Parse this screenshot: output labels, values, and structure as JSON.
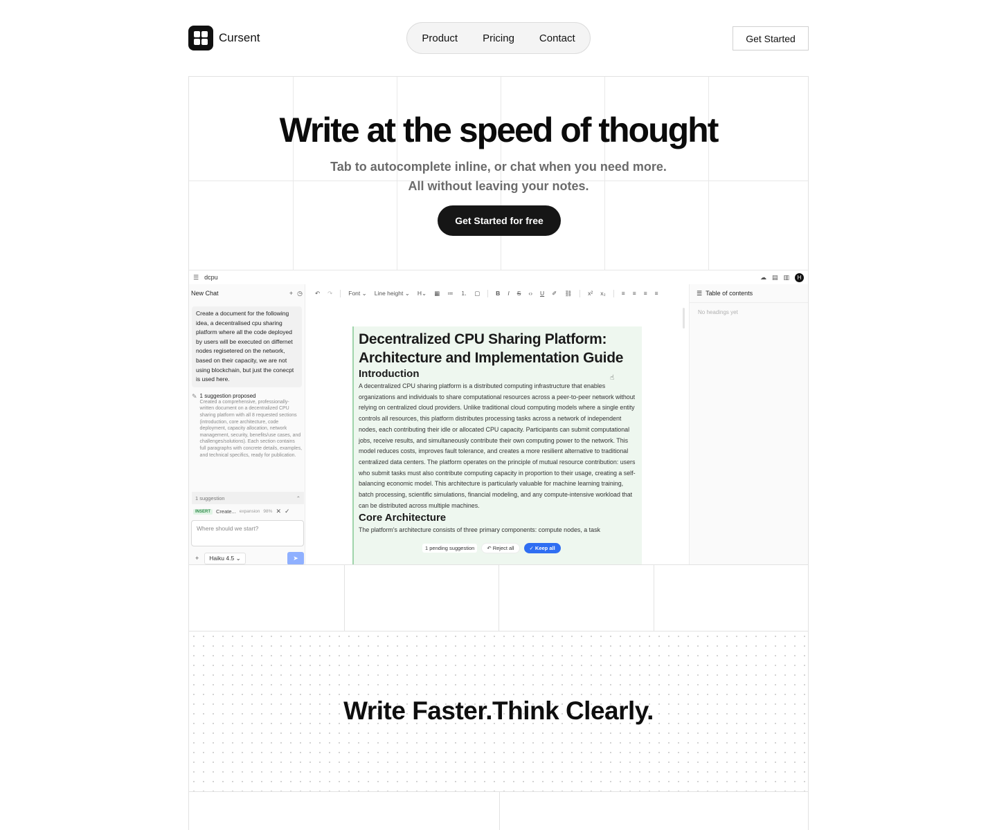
{
  "nav": {
    "brand": "Cursent",
    "links": [
      "Product",
      "Pricing",
      "Contact"
    ],
    "cta": "Get Started"
  },
  "hero": {
    "title": "Write at the speed of thought",
    "subtitle_line1": "Tab to autocomplete inline, or chat when you need more.",
    "subtitle_line2": "All without leaving your notes.",
    "cta": "Get Started for free"
  },
  "app": {
    "doc_name": "dcpu",
    "avatar_initial": "H",
    "chat": {
      "title": "New Chat",
      "user_message": "Create a document for the following idea, a decentralised cpu sharing platform where all the code deployed by users will be executed on differnet nodes regisetered on the network, based on their capacity, we are not using blockchain, but just the conecpt is used here.",
      "suggestion_title": "1 suggestion proposed",
      "suggestion_body": "Created a comprehensive, professionally-written document on a decentralized CPU sharing platform with all 8 requested sections (introduction, core architecture, code deployment, capacity allocation, network management, security, benefits/use cases, and challenges/solutions). Each section contains full paragraphs with concrete details, examples, and technical specifics, ready for publication.",
      "suggestion_count": "1 suggestion",
      "row_badge": "INSERT",
      "row_text": "Create...",
      "row_tag": "expansion",
      "row_conf": "98%",
      "input_placeholder": "Where should we start?",
      "model": "Haiku 4.5"
    },
    "toolbar": {
      "font": "Font",
      "line_height": "Line height",
      "heading": "H"
    },
    "document": {
      "title": "Decentralized CPU Sharing Platform: Architecture and Implementation Guide",
      "intro_heading": "Introduction",
      "intro_p1": "A decentralized CPU sharing platform is a distributed computing infrastructure that enables organizations and individuals to share computational resources across a peer-to-peer network without relying on centralized cloud providers. Unlike traditional cloud computing models where a single entity controls all resources, this platform distributes processing tasks across a network of independent nodes, each contributing their idle or allocated CPU capacity. Participants can submit computational jobs, receive results, and simultaneously contribute their own computing power to the network. This model reduces costs, improves fault tolerance, and creates a more resilient alternative to traditional centralized data centers. The platform operates on the principle of mutual resource contribution: users who submit tasks must also contribute computing capacity in proportion to their usage, creating a self-balancing economic model. This architecture is particularly valuable for machine learning training, batch processing, scientific simulations, financial modeling, and any compute-intensive workload that can be distributed across multiple machines.",
      "core_heading": "Core Architecture",
      "core_p1": "The platform's architecture consists of three primary components: compute nodes, a task"
    },
    "pending": {
      "label": "1 pending suggestion",
      "reject": "Reject all",
      "keep": "Keep all"
    },
    "toc": {
      "title": "Table of contents",
      "empty": "No headings yet"
    }
  },
  "section2": {
    "title": "Write Faster.Think Clearly."
  },
  "colors": {
    "accent": "#2f6ef2",
    "doc_highlight": "#eef7ef",
    "insert_badge": "#2e8b4a"
  }
}
